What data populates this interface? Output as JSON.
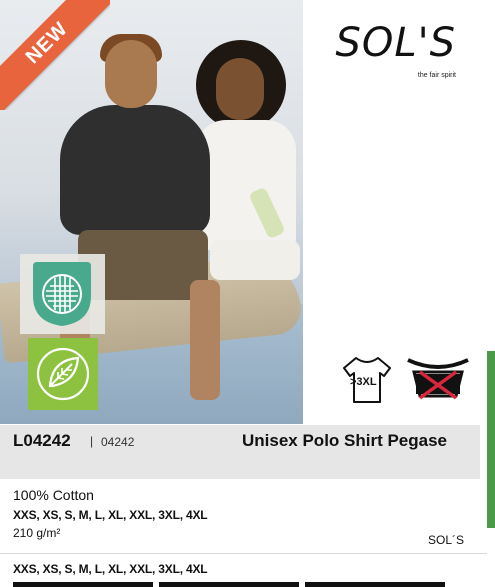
{
  "badge": {
    "text": "NEW"
  },
  "brand": {
    "logo": "SOL'S",
    "tagline": "the fair spirit",
    "footer": "SOL´S"
  },
  "product": {
    "ref": "L04242",
    "ref_separator": "|",
    "ref_small": "04242",
    "name": "Unisex Polo Shirt Pegase",
    "material": "100% Cotton",
    "sizes": "XXS, XS, S, M, L, XL, XXL, 3XL, 4XL",
    "weight": "210 g/m²",
    "sizes_repeat": "XXS, XS, S, M, L, XL, XXL, 3XL, 4XL"
  },
  "icons": {
    "mesh": "pique-mesh-icon",
    "leaf": "organic-leaf-icon",
    "size": "size-3xl-tshirt-icon",
    "size_label": ">3XL",
    "care": "no-wash-icon"
  },
  "colors": {
    "new_ribbon": "#e8643c",
    "mesh_badge": "#49a98d",
    "leaf_badge": "#8cc23f",
    "side_bar": "#4a9a49",
    "title_band": "#e6e6e6",
    "cross": "#d7263d"
  }
}
